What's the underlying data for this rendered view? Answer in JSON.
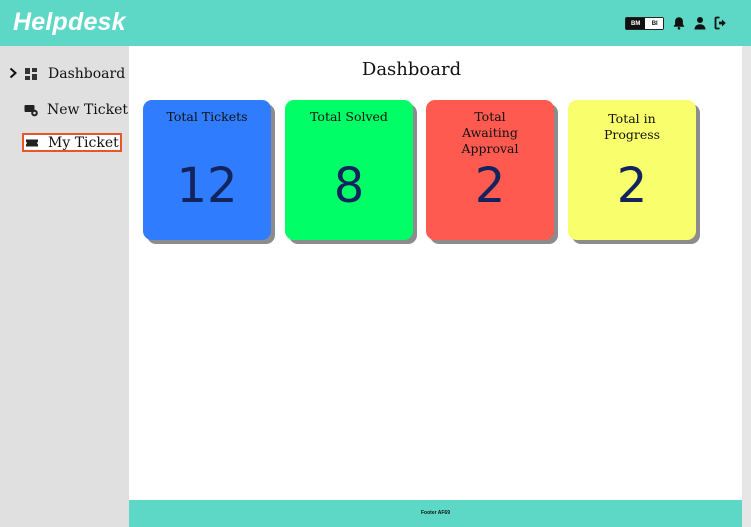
{
  "header": {
    "brand": "Helpdesk",
    "language": {
      "option_bm": "BM",
      "option_bi": "BI"
    },
    "icons": [
      "bell-icon",
      "user-icon",
      "logout-icon"
    ]
  },
  "sidebar": {
    "items": [
      {
        "label": "Dashboard",
        "icon": "dashboard-icon"
      },
      {
        "label": "New Ticket",
        "icon": "new-ticket-icon"
      },
      {
        "label": "My Ticket",
        "icon": "ticket-icon",
        "active": true
      }
    ]
  },
  "main": {
    "title": "Dashboard",
    "cards": [
      {
        "label": "Total Tickets",
        "value": "12",
        "color": "#2f7cff"
      },
      {
        "label": "Total Solved",
        "value": "8",
        "color": "#00ff66"
      },
      {
        "label": "Total Awaiting Approval",
        "value": "2",
        "color": "#ff5a4f"
      },
      {
        "label": "Total in Progress",
        "value": "2",
        "color": "#f9ff6c"
      }
    ]
  },
  "footer": {
    "text": "Footer AF69"
  },
  "colors": {
    "header_bg": "#5dd8c6",
    "sidebar_bg": "#e0e0e0",
    "active_border": "#e8542c",
    "value_text": "#13235e"
  }
}
